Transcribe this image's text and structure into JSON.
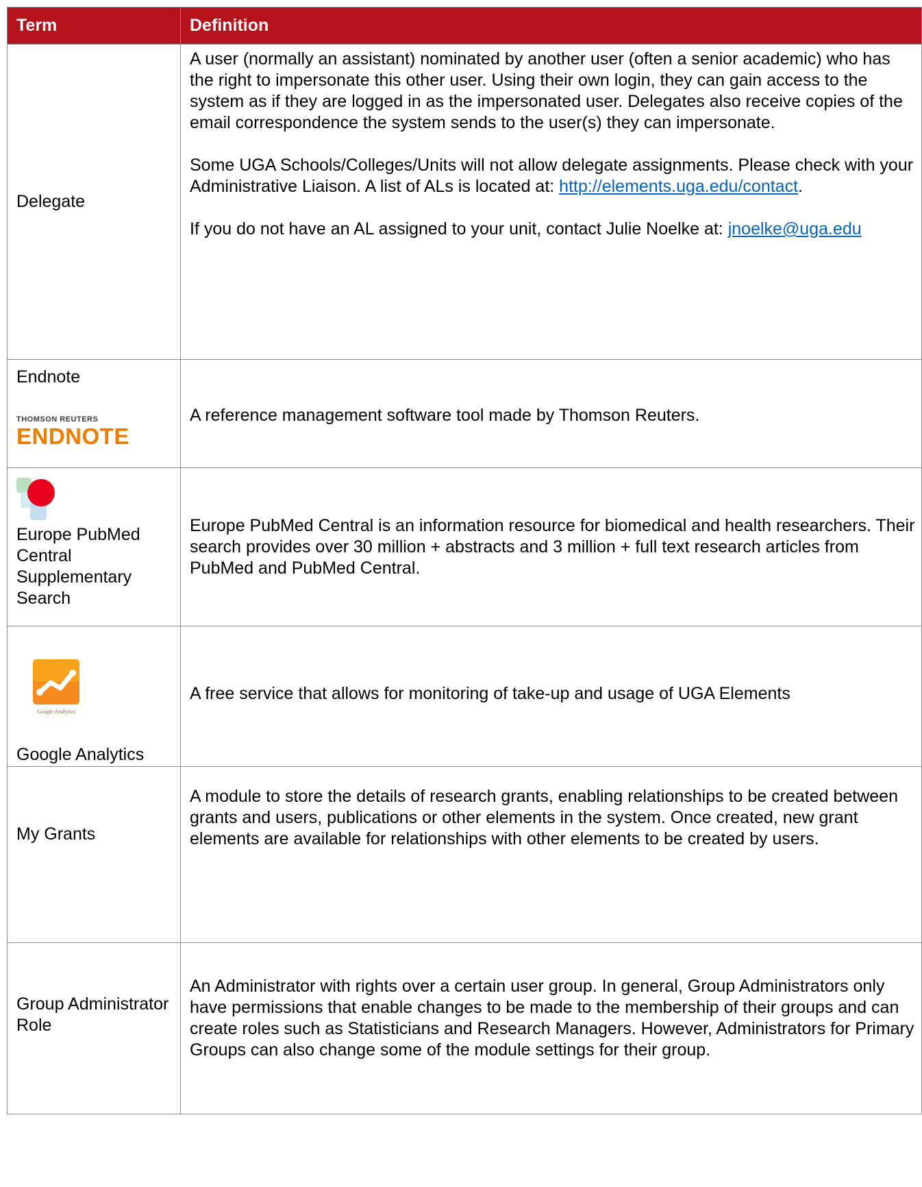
{
  "table": {
    "header": {
      "term": "Term",
      "definition": "Definition"
    },
    "rows": [
      {
        "term": "Delegate",
        "definition": [
          "A user (normally an assistant) nominated by another user (often a senior academic) who has the right to impersonate this other user. Using their own login, they can gain access to the system as if they are logged in as the impersonated user. Delegates also receive copies of the email correspondence the system sends to the user(s) they can impersonate.",
          "Some UGA Schools/Colleges/Units will not allow delegate assignments. Please check with your Administrative Liaison. A list of ALs is located at:",
          "If you do not have an AL assigned to your unit, contact Julie Noelke at:"
        ],
        "link_contact": "http://elements.uga.edu/contact",
        "link_contact_suffix": ".",
        "link_email": "jnoelke@uga.edu"
      },
      {
        "term": "Endnote",
        "logo_small": "THOMSON REUTERS",
        "logo_big": "ENDNOTE",
        "definition": "A reference management software tool made by Thomson Reuters."
      },
      {
        "term": "Europe PubMed Central Supplementary Search",
        "icon": "europe-pmc-icon",
        "definition": "Europe PubMed Central is an information resource for biomedical and health researchers. Their search provides over 30 million + abstracts and 3 million + full text research articles from PubMed and PubMed Central."
      },
      {
        "term": "Google Analytics",
        "icon": "google-analytics-icon",
        "icon_caption": "Google Analytics",
        "definition": "A free service that allows for monitoring of take-up and usage of UGA Elements"
      },
      {
        "term": "My Grants",
        "definition": "A module to store the details of research grants, enabling relationships to be created between grants and users, publications or other elements in the system. Once created, new grant elements are available for relationships with other elements to be created by users."
      },
      {
        "term": "Group Administrator Role",
        "definition": "An Administrator with rights over a certain user group. In general, Group Administrators only have permissions that enable changes to be made to the membership of their groups and can create roles such as Statisticians and Research Managers. However, Administrators for Primary Groups can also change some of the module settings for their group."
      }
    ]
  },
  "colors": {
    "header_bg": "#b5121b",
    "link": "#0563c1",
    "endnote_orange": "#f07d00"
  }
}
